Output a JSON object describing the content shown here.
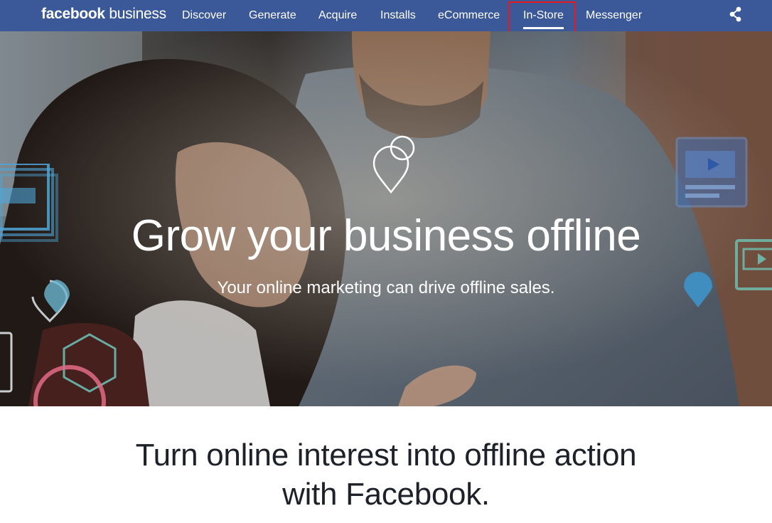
{
  "brand": {
    "part1": "facebook",
    "part2": "business"
  },
  "nav": {
    "items": [
      {
        "label": "Discover"
      },
      {
        "label": "Generate"
      },
      {
        "label": "Acquire"
      },
      {
        "label": "Installs"
      },
      {
        "label": "eCommerce"
      },
      {
        "label": "In-Store"
      },
      {
        "label": "Messenger"
      }
    ],
    "active": "In-Store",
    "share_icon": "share-icon"
  },
  "hero": {
    "icon": "location-pins-icon",
    "title": "Grow your business offline",
    "subtitle": "Your online marketing can drive offline sales."
  },
  "section": {
    "title_line1": "Turn online interest into offline action",
    "title_line2": "with Facebook."
  },
  "colors": {
    "nav_bg": "#3b5998",
    "highlight": "#e8191e",
    "text_dark": "#1d2129"
  }
}
